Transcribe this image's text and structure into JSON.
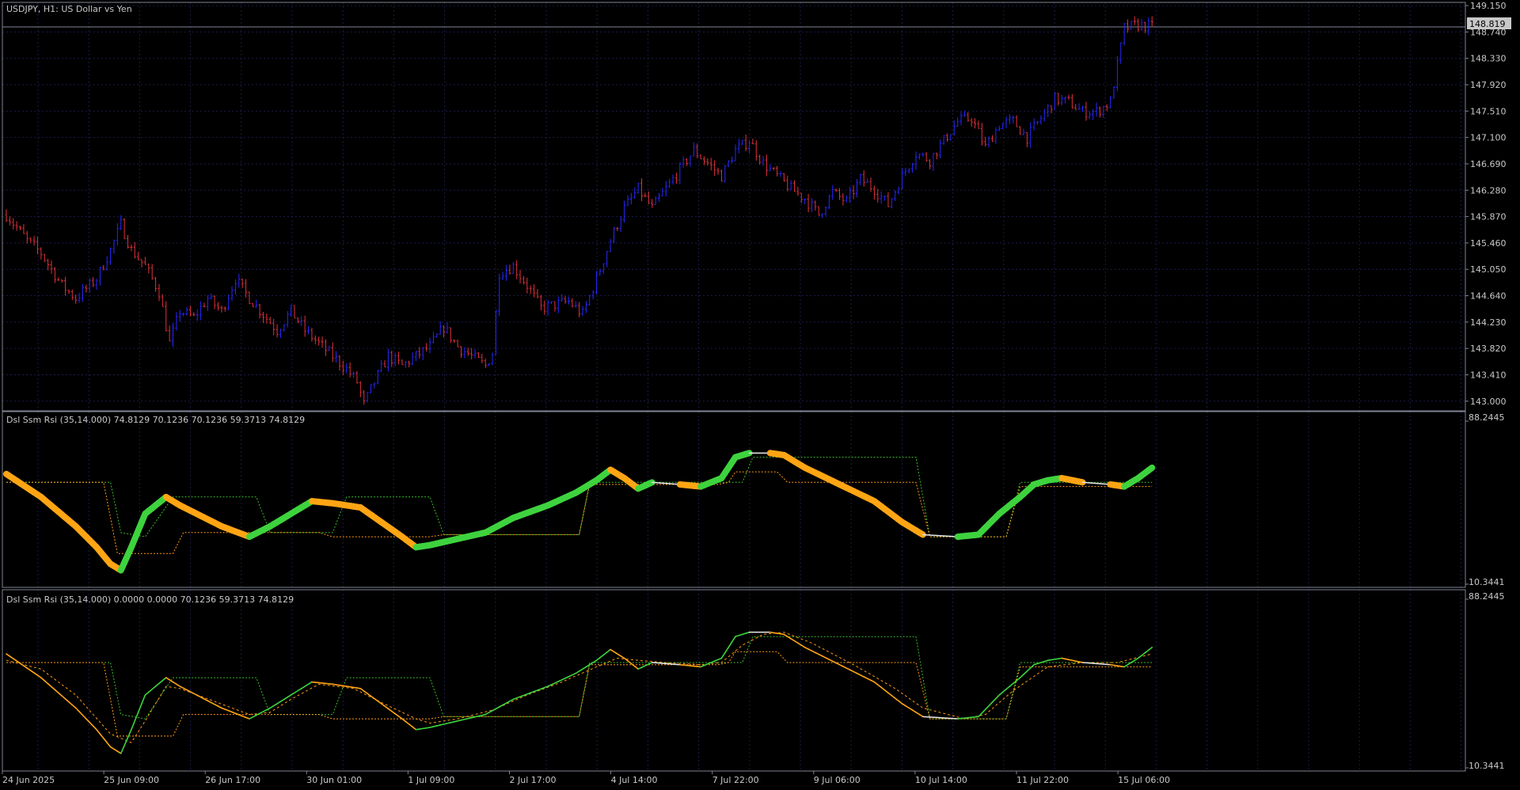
{
  "window": {
    "symbol_title": "USDJPY, H1:  US Dollar vs Yen",
    "current_price": "148.819"
  },
  "colors": {
    "background": "#000000",
    "grid": "#1b1d4a",
    "frame": "#7f8593",
    "text": "#c8c8c8",
    "bar_up": "#2727ff",
    "bar_down": "#e0303a",
    "rsi_up": "#3ed33e",
    "rsi_down": "#ffa514",
    "signal_white": "#e8e8e8",
    "level_green": "#3bbf2b",
    "level_orange": "#ff9c14",
    "price_label_bg": "#c8c8c8"
  },
  "time_axis": [
    "24 Jun 2025",
    "25 Jun 09:00",
    "26 Jun 17:00",
    "30 Jun 01:00",
    "1 Jul 09:00",
    "2 Jul 17:00",
    "4 Jul 14:00",
    "7 Jul 22:00",
    "9 Jul 06:00",
    "10 Jul 14:00",
    "11 Jul 22:00",
    "15 Jul 06:00"
  ],
  "panels": [
    {
      "id": "price",
      "y_ticks": [
        "149.150",
        "148.740",
        "148.330",
        "147.920",
        "147.510",
        "147.100",
        "146.690",
        "146.280",
        "145.870",
        "145.460",
        "145.050",
        "144.640",
        "144.230",
        "143.820",
        "143.410",
        "143.000"
      ]
    },
    {
      "id": "rsi1",
      "legend": "Dsl Ssm Rsi (35,14.000) 74.8129 70.1236 70.1236 59.3713 74.8129",
      "y_max": "88.2445",
      "y_min": "10.3441"
    },
    {
      "id": "rsi2",
      "legend": "Dsl Ssm Rsi (35,14.000) 0.0000 0.0000 70.1236 59.3713 74.8129",
      "y_max": "88.2445",
      "y_min": "10.3441"
    }
  ],
  "chart_data": [
    {
      "type": "candlestick",
      "title": "USDJPY, H1:  US Dollar vs Yen",
      "ylim": [
        142.85,
        149.2
      ],
      "last_price": 148.819,
      "close_path": [
        [
          0,
          145.9
        ],
        [
          6,
          145.5
        ],
        [
          10,
          145.3
        ],
        [
          16,
          144.8
        ],
        [
          20,
          144.6
        ],
        [
          26,
          144.9
        ],
        [
          30,
          145.35
        ],
        [
          33,
          145.75
        ],
        [
          36,
          145.35
        ],
        [
          40,
          145.1
        ],
        [
          44,
          144.7
        ],
        [
          47,
          143.9
        ],
        [
          50,
          144.4
        ],
        [
          54,
          144.3
        ],
        [
          58,
          144.6
        ],
        [
          62,
          144.4
        ],
        [
          66,
          144.9
        ],
        [
          70,
          144.6
        ],
        [
          74,
          144.35
        ],
        [
          78,
          144.1
        ],
        [
          82,
          144.4
        ],
        [
          86,
          144.1
        ],
        [
          90,
          143.9
        ],
        [
          94,
          143.7
        ],
        [
          98,
          143.5
        ],
        [
          101,
          143.3
        ],
        [
          103,
          142.95
        ],
        [
          106,
          143.3
        ],
        [
          110,
          143.7
        ],
        [
          114,
          143.55
        ],
        [
          118,
          143.7
        ],
        [
          122,
          143.85
        ],
        [
          126,
          144.15
        ],
        [
          130,
          143.85
        ],
        [
          134,
          143.7
        ],
        [
          138,
          143.55
        ],
        [
          140,
          143.75
        ],
        [
          142,
          145.0
        ],
        [
          146,
          145.1
        ],
        [
          150,
          144.8
        ],
        [
          154,
          144.45
        ],
        [
          158,
          144.5
        ],
        [
          162,
          144.55
        ],
        [
          166,
          144.35
        ],
        [
          170,
          144.9
        ],
        [
          174,
          145.5
        ],
        [
          178,
          146.0
        ],
        [
          182,
          146.3
        ],
        [
          186,
          146.0
        ],
        [
          190,
          146.3
        ],
        [
          194,
          146.6
        ],
        [
          198,
          146.9
        ],
        [
          202,
          146.7
        ],
        [
          206,
          146.5
        ],
        [
          210,
          146.9
        ],
        [
          214,
          147.05
        ],
        [
          218,
          146.7
        ],
        [
          222,
          146.5
        ],
        [
          226,
          146.3
        ],
        [
          230,
          146.15
        ],
        [
          234,
          145.9
        ],
        [
          238,
          146.25
        ],
        [
          242,
          146.1
        ],
        [
          246,
          146.45
        ],
        [
          250,
          146.3
        ],
        [
          254,
          146.05
        ],
        [
          258,
          146.5
        ],
        [
          262,
          146.85
        ],
        [
          266,
          146.75
        ],
        [
          270,
          147.05
        ],
        [
          274,
          147.35
        ],
        [
          278,
          147.4
        ],
        [
          282,
          146.95
        ],
        [
          286,
          147.3
        ],
        [
          290,
          147.35
        ],
        [
          294,
          147.1
        ],
        [
          298,
          147.4
        ],
        [
          302,
          147.7
        ],
        [
          306,
          147.65
        ],
        [
          310,
          147.5
        ],
        [
          314,
          147.5
        ],
        [
          318,
          147.65
        ],
        [
          322,
          148.8
        ],
        [
          326,
          148.85
        ],
        [
          330,
          148.82
        ]
      ]
    },
    {
      "type": "line",
      "title": "Dsl Ssm Rsi (35,14.000)",
      "ylim": [
        10.3441,
        88.2445
      ],
      "values_shown": [
        74.8129,
        70.1236,
        70.1236,
        59.3713,
        74.8129
      ],
      "rsi_path": [
        [
          0,
          63
        ],
        [
          10,
          52
        ],
        [
          20,
          38
        ],
        [
          26,
          28
        ],
        [
          30,
          20
        ],
        [
          33,
          17
        ],
        [
          36,
          28
        ],
        [
          40,
          44
        ],
        [
          46,
          52
        ],
        [
          50,
          48
        ],
        [
          56,
          43
        ],
        [
          62,
          38
        ],
        [
          70,
          33
        ],
        [
          76,
          38
        ],
        [
          82,
          44
        ],
        [
          88,
          50
        ],
        [
          94,
          49
        ],
        [
          102,
          47
        ],
        [
          108,
          40
        ],
        [
          114,
          33
        ],
        [
          118,
          28
        ],
        [
          122,
          29
        ],
        [
          130,
          32
        ],
        [
          138,
          35
        ],
        [
          146,
          42
        ],
        [
          156,
          48
        ],
        [
          164,
          54
        ],
        [
          170,
          60
        ],
        [
          174,
          65
        ],
        [
          178,
          61
        ],
        [
          182,
          56
        ],
        [
          186,
          59
        ],
        [
          194,
          58
        ],
        [
          200,
          57
        ],
        [
          206,
          61
        ],
        [
          210,
          71
        ],
        [
          214,
          73
        ],
        [
          220,
          73
        ],
        [
          224,
          72
        ],
        [
          230,
          66
        ],
        [
          240,
          58
        ],
        [
          250,
          50
        ],
        [
          258,
          40
        ],
        [
          264,
          34
        ],
        [
          274,
          33
        ],
        [
          280,
          34
        ],
        [
          286,
          44
        ],
        [
          292,
          52
        ],
        [
          296,
          58
        ],
        [
          300,
          60
        ],
        [
          304,
          61
        ],
        [
          310,
          59
        ],
        [
          318,
          58
        ],
        [
          322,
          57
        ],
        [
          326,
          61
        ],
        [
          330,
          66
        ]
      ],
      "signal_dashed_path": [
        [
          0,
          60
        ],
        [
          10,
          56
        ],
        [
          20,
          44
        ],
        [
          30,
          26
        ],
        [
          36,
          22
        ],
        [
          40,
          32
        ],
        [
          46,
          48
        ],
        [
          50,
          47
        ],
        [
          60,
          41
        ],
        [
          70,
          35
        ],
        [
          76,
          36
        ],
        [
          82,
          42
        ],
        [
          90,
          49
        ],
        [
          100,
          47
        ],
        [
          110,
          39
        ],
        [
          118,
          33
        ],
        [
          122,
          31
        ],
        [
          130,
          33
        ],
        [
          140,
          37
        ],
        [
          150,
          44
        ],
        [
          160,
          50
        ],
        [
          170,
          57
        ],
        [
          176,
          61
        ],
        [
          182,
          60
        ],
        [
          190,
          59
        ],
        [
          200,
          58
        ],
        [
          206,
          59
        ],
        [
          212,
          67
        ],
        [
          218,
          72
        ],
        [
          224,
          73
        ],
        [
          232,
          68
        ],
        [
          244,
          58
        ],
        [
          256,
          47
        ],
        [
          264,
          38
        ],
        [
          276,
          33
        ],
        [
          282,
          35
        ],
        [
          290,
          46
        ],
        [
          300,
          57
        ],
        [
          310,
          59
        ],
        [
          320,
          59
        ],
        [
          330,
          63
        ]
      ],
      "upper_level_path": [
        [
          0,
          59
        ],
        [
          30,
          59
        ],
        [
          33,
          35
        ],
        [
          40,
          33
        ],
        [
          48,
          52
        ],
        [
          72,
          52
        ],
        [
          76,
          35
        ],
        [
          94,
          35
        ],
        [
          98,
          52
        ],
        [
          122,
          52
        ],
        [
          126,
          34
        ],
        [
          165,
          34
        ],
        [
          168,
          59
        ],
        [
          212,
          59
        ],
        [
          215,
          71
        ],
        [
          262,
          71
        ],
        [
          266,
          33
        ],
        [
          288,
          33
        ],
        [
          292,
          59
        ],
        [
          330,
          59
        ]
      ],
      "lower_level_path": [
        [
          0,
          59
        ],
        [
          28,
          59
        ],
        [
          32,
          25
        ],
        [
          48,
          25
        ],
        [
          51,
          35
        ],
        [
          90,
          35
        ],
        [
          94,
          33
        ],
        [
          122,
          33
        ],
        [
          126,
          34
        ],
        [
          165,
          34
        ],
        [
          168,
          58
        ],
        [
          205,
          58
        ],
        [
          208,
          59
        ],
        [
          210,
          64
        ],
        [
          222,
          64
        ],
        [
          225,
          59
        ],
        [
          262,
          59
        ],
        [
          266,
          33
        ],
        [
          288,
          33
        ],
        [
          292,
          57
        ],
        [
          330,
          57
        ]
      ]
    }
  ]
}
